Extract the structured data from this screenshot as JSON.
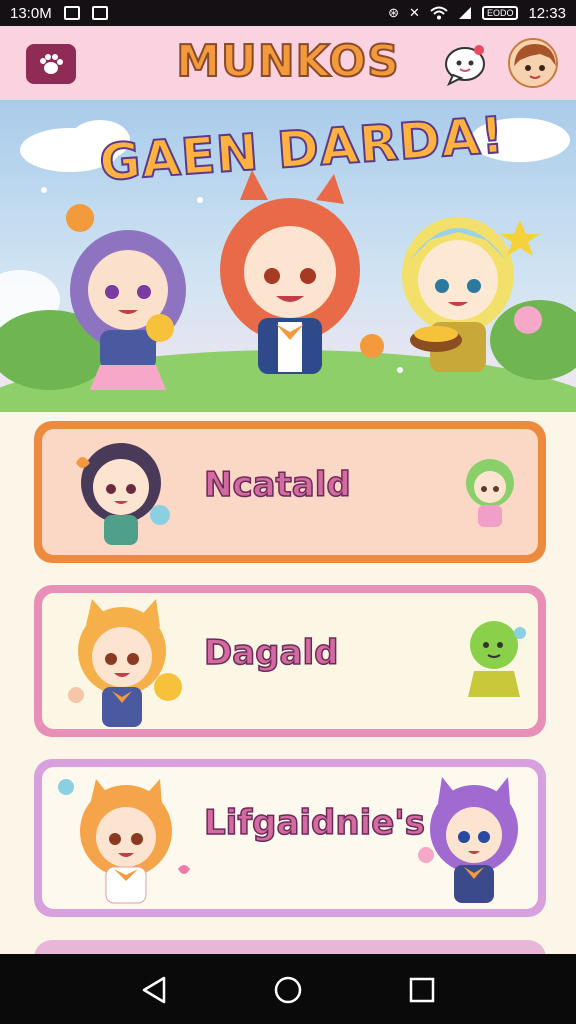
{
  "status_bar": {
    "time_left": "13:0M",
    "time_right": "12:33",
    "battery_text": "EODO"
  },
  "header": {
    "title": "MUNKOS"
  },
  "hero": {
    "title": "GAEN DARDA!"
  },
  "cards": [
    {
      "label": "Ncatald"
    },
    {
      "label": "Dagald"
    },
    {
      "label": "Lifgaidnie's"
    }
  ],
  "colors": {
    "header_bg": "#fbd3e0",
    "menu_button": "#8e2c55",
    "title_orange": "#f39a3c",
    "card1_border": "#ec8a3d",
    "card2_border": "#e78fb7",
    "card3_border": "#d8a0dc",
    "label_pink": "#d46aa2"
  },
  "icons": {
    "menu": "paw-icon",
    "chat": "chat-bubble-icon",
    "avatar": "user-avatar",
    "nav_back": "back-triangle-icon",
    "nav_home": "home-circle-icon",
    "nav_recent": "recent-square-icon"
  }
}
